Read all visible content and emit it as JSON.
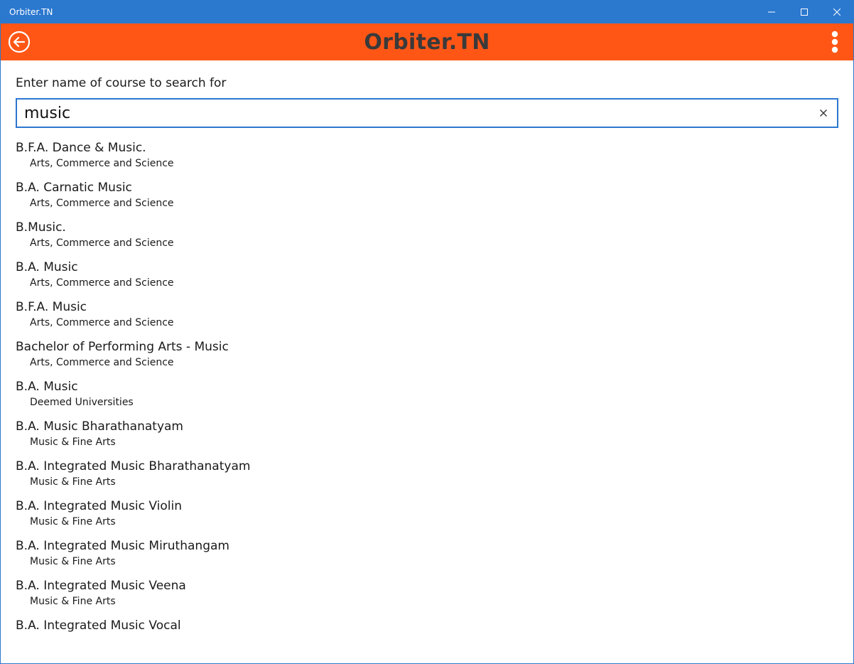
{
  "window": {
    "title": "Orbiter.TN"
  },
  "appbar": {
    "title": "Orbiter.TN"
  },
  "search": {
    "label": "Enter name of course to search for",
    "value": "music"
  },
  "results": [
    {
      "title": "B.F.A. Dance & Music.",
      "category": "Arts, Commerce and Science"
    },
    {
      "title": "B.A. Carnatic Music",
      "category": "Arts, Commerce and Science"
    },
    {
      "title": "B.Music.",
      "category": "Arts, Commerce and Science"
    },
    {
      "title": "B.A. Music",
      "category": "Arts, Commerce and Science"
    },
    {
      "title": "B.F.A. Music",
      "category": "Arts, Commerce and Science"
    },
    {
      "title": "Bachelor of Performing Arts - Music",
      "category": "Arts, Commerce and Science"
    },
    {
      "title": "B.A. Music",
      "category": "Deemed Universities"
    },
    {
      "title": "B.A. Music Bharathanatyam",
      "category": "Music & Fine Arts"
    },
    {
      "title": "B.A. Integrated Music Bharathanatyam",
      "category": "Music & Fine Arts"
    },
    {
      "title": "B.A. Integrated Music Violin",
      "category": "Music & Fine Arts"
    },
    {
      "title": "B.A. Integrated Music Miruthangam",
      "category": "Music & Fine Arts"
    },
    {
      "title": "B.A. Integrated Music Veena",
      "category": "Music & Fine Arts"
    },
    {
      "title": "B.A. Integrated Music Vocal",
      "category": ""
    }
  ],
  "colors": {
    "titlebar": "#2b78cf",
    "appbar": "#ff5616",
    "accent": "#2b78cf"
  },
  "icons": {
    "back": "back-arrow-icon",
    "more": "more-vertical-icon",
    "clear": "close-icon",
    "minimize": "minimize-icon",
    "maximize": "maximize-icon",
    "close": "close-icon"
  }
}
